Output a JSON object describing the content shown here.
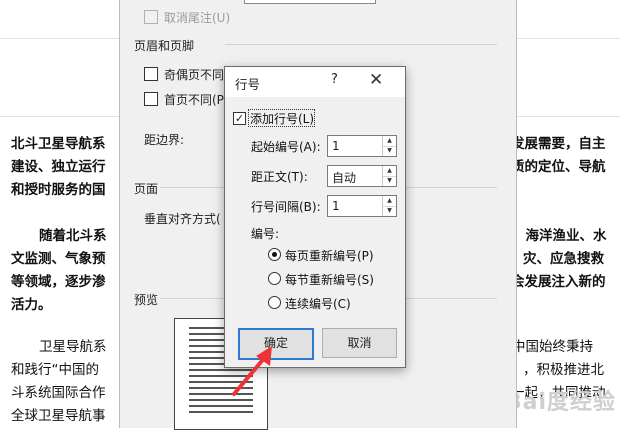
{
  "document": {
    "paragraphs": [
      {
        "left": "北斗卫星导航系",
        "right": "发展需要，自主",
        "bold": true
      },
      {
        "left": "建设、独立运行",
        "right": "质的定位、导航",
        "bold": true
      },
      {
        "left": "和授时服务的国",
        "right": "",
        "bold": true
      },
      {
        "left": "随着北斗系",
        "right": "、海洋渔业、水",
        "bold": true
      },
      {
        "left": "文监测、气象预",
        "right": "灾、应急搜救",
        "bold": true
      },
      {
        "left": "等领域，逐步渗",
        "right": "会发展注入新的",
        "bold": true
      },
      {
        "left": "活力。",
        "right": "",
        "bold": true
      },
      {
        "left": "卫星导航系",
        "right": "中国始终秉持",
        "bold": false
      },
      {
        "left": "和践行“中国的",
        "right": "，积极推进北",
        "bold": false
      },
      {
        "left": "斗系统国际合作",
        "right": "一起，共同推动",
        "bold": false
      },
      {
        "left": "全球卫星导航事",
        "right": "",
        "bold": false
      }
    ],
    "watermark": "Bai度经验"
  },
  "page_setup": {
    "cancel_endnote": "取消尾注(U)",
    "header_footer_section": "页眉和页脚",
    "odd_even": "奇偶页不同(",
    "first_page": "首页不同(P",
    "from_edge": "距边界:",
    "page_section": "页面",
    "vertical_align": "垂直对齐方式(",
    "preview_section": "预览"
  },
  "line_numbers_dialog": {
    "title": "行号",
    "help": "?",
    "close": "✕",
    "add_line_numbers": "添加行号(L)",
    "start_at_label": "起始编号(A):",
    "start_at_value": "1",
    "from_text_label": "距正文(T):",
    "from_text_value": "自动",
    "count_by_label": "行号间隔(B):",
    "count_by_value": "1",
    "numbering_label": "编号:",
    "options": [
      "每页重新编号(P)",
      "每节重新编号(S)",
      "连续编号(C)"
    ],
    "selected_option": 0,
    "ok_label": "确定",
    "cancel_label": "取消"
  }
}
